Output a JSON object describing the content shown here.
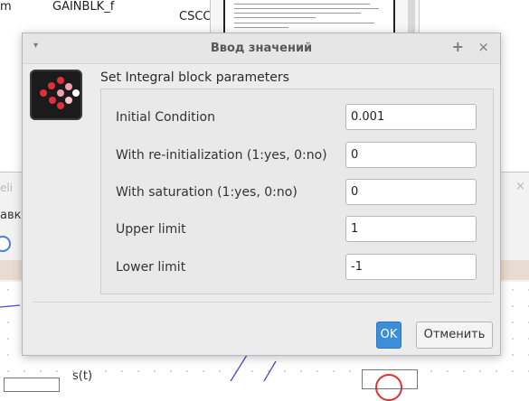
{
  "background": {
    "text_m": "m",
    "text_gainblk": "GAINBLK_f",
    "text_csc": "CSCC",
    "window_title_fragment": "eli",
    "menu_fragment": "авк",
    "close_glyph": "×",
    "signal_label": "s(t)"
  },
  "dialog": {
    "title": "Ввод значений",
    "menu_glyph": "▾",
    "pin_glyph": "+",
    "close_glyph": "×",
    "heading": "Set Integral block parameters",
    "fields": [
      {
        "label": "Initial Condition",
        "value": "0.001"
      },
      {
        "label": "With re-initialization (1:yes, 0:no)",
        "value": "0"
      },
      {
        "label": "With saturation (1:yes, 0:no)",
        "value": "0"
      },
      {
        "label": "Upper limit",
        "value": "1"
      },
      {
        "label": "Lower limit",
        "value": "-1"
      }
    ],
    "ok_label": "OK",
    "cancel_label": "Отменить"
  },
  "colors": {
    "accent": "#3b8ed9",
    "icon_red": "#e0303a",
    "icon_pink": "#f2a0b0"
  }
}
